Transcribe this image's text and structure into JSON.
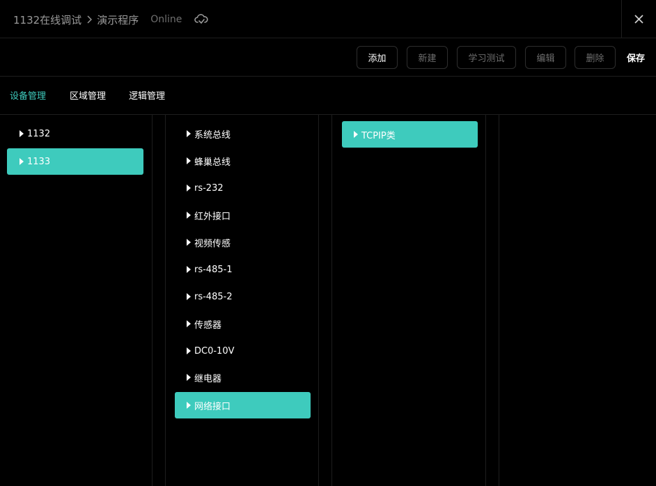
{
  "header": {
    "breadcrumb_root": "1132在线调试",
    "breadcrumb_current": "演示程序",
    "status": "Online"
  },
  "toolbar": {
    "add": "添加",
    "new": "新建",
    "learn_test": "学习测试",
    "edit": "编辑",
    "delete": "删除",
    "save": "保存"
  },
  "tabs": {
    "device": "设备管理",
    "area": "区域管理",
    "logic": "逻辑管理"
  },
  "columns": {
    "hosts": [
      "1132",
      "1133"
    ],
    "interfaces": [
      "系统总线",
      "蜂巢总线",
      "rs-232",
      "红外接口",
      "视频传感",
      "rs-485-1",
      "rs-485-2",
      "传感器",
      "DC0-10V",
      "继电器",
      "网络接口"
    ],
    "types": [
      "TCPIP类"
    ]
  },
  "colors": {
    "accent": "#3ecbbd",
    "background": "#000000",
    "border": "#2e2e2e"
  }
}
